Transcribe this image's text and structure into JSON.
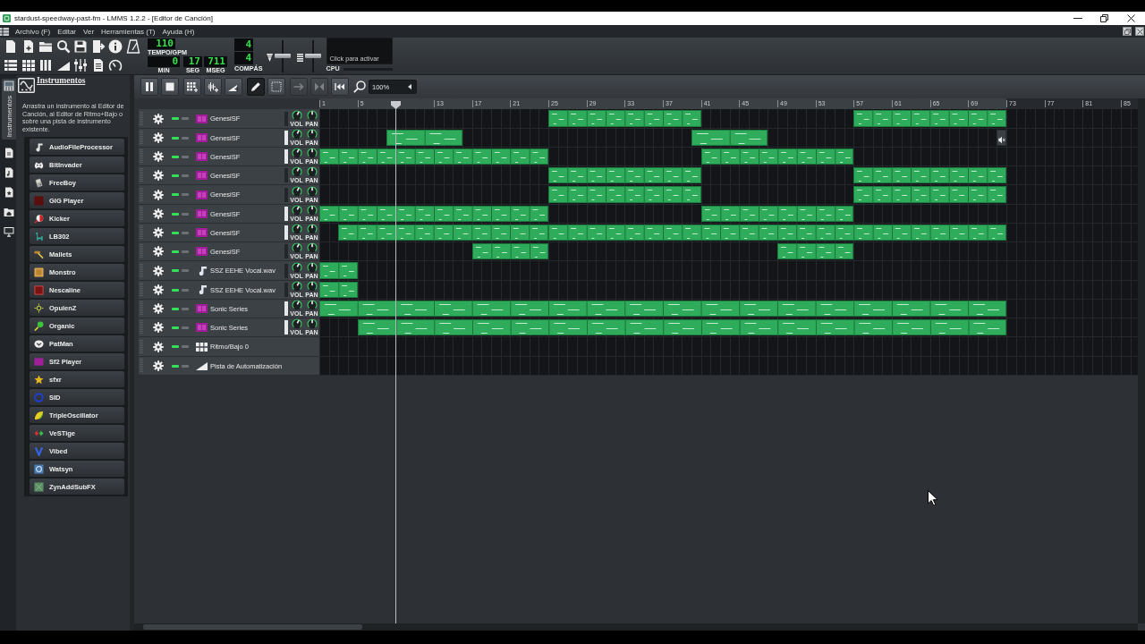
{
  "window": {
    "title": "stardust-speedway-past-fm - LMMS 1.2.2 - [Editor de Canción]"
  },
  "menu": [
    "Archivo (F)",
    "Editar",
    "Ver",
    "Herramientas (T)",
    "Ayuda (H)"
  ],
  "toolbar": {
    "tempo": {
      "value": "110",
      "label": "TEMPO/GPM"
    },
    "time": [
      {
        "value": "0",
        "label": "MIN"
      },
      {
        "value": "17",
        "label": "SEG"
      },
      {
        "value": "711",
        "label": "MSEG"
      }
    ],
    "time_signature": {
      "numerator": "4",
      "denominator": "4",
      "label": "COMPÁS"
    },
    "master_volume": {
      "level": 0.5
    },
    "master_pitch": {
      "level": 0.5
    },
    "cpu": {
      "hint": "Click para activar",
      "label": "CPU"
    }
  },
  "sidebar": {
    "tabs": [
      {
        "kind": "instruments",
        "label": "Instrumentos",
        "selected": true
      },
      {
        "kind": "projects",
        "selected": false
      },
      {
        "kind": "samples",
        "selected": false
      },
      {
        "kind": "presets",
        "selected": false
      },
      {
        "kind": "home",
        "selected": false
      },
      {
        "kind": "computer",
        "selected": false
      }
    ],
    "panel": {
      "title": "Instrumentos",
      "description": "Arrastra un instrumento al Editor de Canción, al Editor de Ritmo+Bajo o sobre una pista de instrumento existente.",
      "instruments": [
        "AudioFileProcessor",
        "BitInvader",
        "FreeBoy",
        "GIG Player",
        "Kicker",
        "LB302",
        "Mallets",
        "Monstro",
        "Nescaline",
        "OpulenZ",
        "Organic",
        "PatMan",
        "Sf2 Player",
        "sfxr",
        "SID",
        "TripleOscillator",
        "VeSTige",
        "Vibed",
        "Watsyn",
        "ZynAddSubFX"
      ]
    }
  },
  "song_editor": {
    "modes": [
      {
        "kind": "draw",
        "selected": true
      },
      {
        "kind": "select",
        "selected": false
      }
    ],
    "options": [
      {
        "kind": "auto-scroll",
        "on": false
      },
      {
        "kind": "loop",
        "on": false
      }
    ],
    "zoom": "100%",
    "ruler": [
      "1",
      "5",
      "13",
      "17",
      "21",
      "25",
      "29",
      "33",
      "37",
      "41",
      "45",
      "49",
      "53",
      "57",
      "61",
      "65",
      "69",
      "73",
      "77",
      "81",
      "85"
    ],
    "tracks": [
      {
        "name": "GenesiSF",
        "kind": "sf2",
        "muted": false,
        "solo": false,
        "active": false,
        "volume": {
          "label": "VOL",
          "level": 0.6
        },
        "pan": {
          "label": "PAN",
          "level": 0.5
        },
        "clips": [
          {
            "muted": false
          },
          {
            "muted": false
          }
        ]
      },
      {
        "name": "GenesiSF",
        "kind": "sf2",
        "muted": false,
        "solo": false,
        "active": true,
        "volume": {
          "label": "VOL",
          "level": 0.6
        },
        "pan": {
          "label": "PAN",
          "level": 0.5
        },
        "clips": [
          {
            "muted": false
          },
          {
            "muted": false
          },
          {
            "muted": true
          }
        ]
      },
      {
        "name": "GenesiSF",
        "kind": "sf2",
        "muted": false,
        "solo": false,
        "active": true,
        "volume": {
          "label": "VOL",
          "level": 0.6
        },
        "pan": {
          "label": "PAN",
          "level": 0.5
        },
        "clips": [
          {
            "muted": false
          },
          {
            "muted": false
          }
        ]
      },
      {
        "name": "GenesiSF",
        "kind": "sf2",
        "muted": false,
        "solo": false,
        "active": false,
        "volume": {
          "label": "VOL",
          "level": 0.6
        },
        "pan": {
          "label": "PAN",
          "level": 0.5
        },
        "clips": [
          {
            "muted": false
          },
          {
            "muted": false
          }
        ]
      },
      {
        "name": "GenesiSF",
        "kind": "sf2",
        "muted": false,
        "solo": false,
        "active": false,
        "volume": {
          "label": "VOL",
          "level": 0.6
        },
        "pan": {
          "label": "PAN",
          "level": 0.5
        },
        "clips": [
          {
            "muted": false
          },
          {
            "muted": false
          }
        ]
      },
      {
        "name": "GenesiSF",
        "kind": "sf2",
        "muted": false,
        "solo": false,
        "active": true,
        "volume": {
          "label": "VOL",
          "level": 0.6
        },
        "pan": {
          "label": "PAN",
          "level": 0.5
        },
        "clips": [
          {
            "muted": false
          },
          {
            "muted": false
          }
        ]
      },
      {
        "name": "GenesiSF",
        "kind": "sf2",
        "muted": false,
        "solo": false,
        "active": true,
        "volume": {
          "label": "VOL",
          "level": 0.6
        },
        "pan": {
          "label": "PAN",
          "level": 0.5
        },
        "clips": [
          {
            "muted": false
          },
          {
            "muted": false
          }
        ]
      },
      {
        "name": "GenesiSF",
        "kind": "sf2",
        "muted": false,
        "solo": false,
        "active": false,
        "volume": {
          "label": "VOL",
          "level": 0.6
        },
        "pan": {
          "label": "PAN",
          "level": 0.5
        },
        "clips": [
          {
            "muted": false
          },
          {
            "muted": false
          }
        ]
      },
      {
        "name": "SSZ EEHE Vocal.wav",
        "kind": "audiofile",
        "muted": false,
        "solo": false,
        "active": false,
        "volume": {
          "label": "VOL",
          "level": 0.6
        },
        "pan": {
          "label": "PAN",
          "level": 0.5
        },
        "clips": [
          {
            "muted": false
          }
        ]
      },
      {
        "name": "SSZ EEHE Vocal.wav",
        "kind": "audiofile",
        "muted": false,
        "solo": false,
        "active": false,
        "volume": {
          "label": "VOL",
          "level": 0.6
        },
        "pan": {
          "label": "PAN",
          "level": 0.5
        },
        "clips": [
          {
            "muted": false
          }
        ]
      },
      {
        "name": "Sonic Series",
        "kind": "sf2",
        "muted": false,
        "solo": false,
        "active": true,
        "volume": {
          "label": "VOL",
          "level": 0.6
        },
        "pan": {
          "label": "PAN",
          "level": 0.5
        },
        "clips": [
          {
            "muted": false
          }
        ]
      },
      {
        "name": "Sonic Series",
        "kind": "sf2",
        "muted": false,
        "solo": false,
        "active": true,
        "volume": {
          "label": "VOL",
          "level": 0.6
        },
        "pan": {
          "label": "PAN",
          "level": 0.5
        },
        "clips": [
          {
            "muted": false
          }
        ]
      },
      {
        "name": "Ritmo/Bajo 0",
        "kind": "beat-bass",
        "muted": false,
        "solo": false
      },
      {
        "name": "Pista de Automatización",
        "kind": "automation",
        "muted": false,
        "solo": false
      }
    ]
  }
}
